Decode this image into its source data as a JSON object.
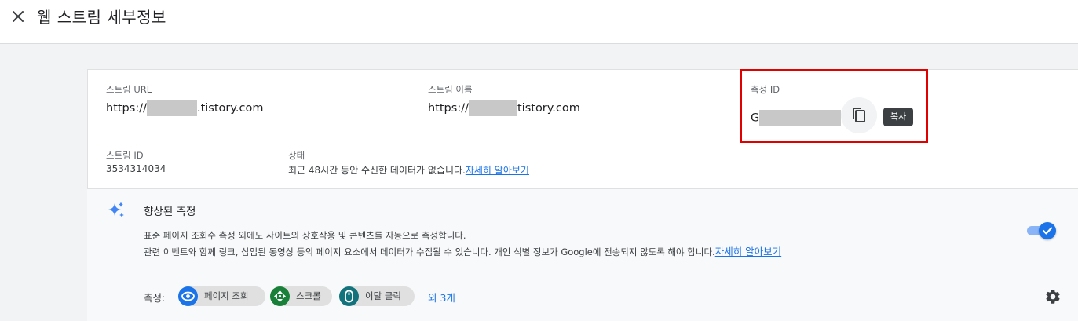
{
  "header": {
    "title": "웹 스트림 세부정보"
  },
  "stream": {
    "url_label": "스트림 URL",
    "url_prefix": "https://",
    "url_suffix": ".tistory.com",
    "name_label": "스트림 이름",
    "name_prefix": "https://",
    "name_suffix": "tistory.com",
    "measurement_id_label": "측정 ID",
    "measurement_id_prefix": "G",
    "copy_tooltip": "복사",
    "stream_id_label": "스트림 ID",
    "stream_id": "3534314034",
    "status_label": "상태",
    "status_text": "최근 48시간 동안 수신한 데이터가 없습니다.",
    "status_link": "자세히 알아보기"
  },
  "enhanced": {
    "title": "향상된 측정",
    "desc_line1": "표준 페이지 조회수 측정 외에도 사이트의 상호작용 및 콘텐츠를 자동으로 측정합니다.",
    "desc_line2": "관련 이벤트와 함께 링크, 삽입된 동영상 등의 페이지 요소에서 데이터가 수집될 수 있습니다. 개인 식별 정보가 Google에 전송되지 않도록 해야 합니다.",
    "desc_link": "자세히 알아보기",
    "toggle_on": true,
    "measures_label": "측정:",
    "chips": [
      {
        "label": "페이지 조회",
        "icon": "eye-icon",
        "color": "#1a73e8"
      },
      {
        "label": "스크롤",
        "icon": "scroll-icon",
        "color": "#188038"
      },
      {
        "label": "이탈 클릭",
        "icon": "mouse-icon",
        "color": "#12737d"
      }
    ],
    "more_link": "외 3개"
  },
  "colors": {
    "accent": "#1a73e8",
    "highlight": "#e00000"
  }
}
